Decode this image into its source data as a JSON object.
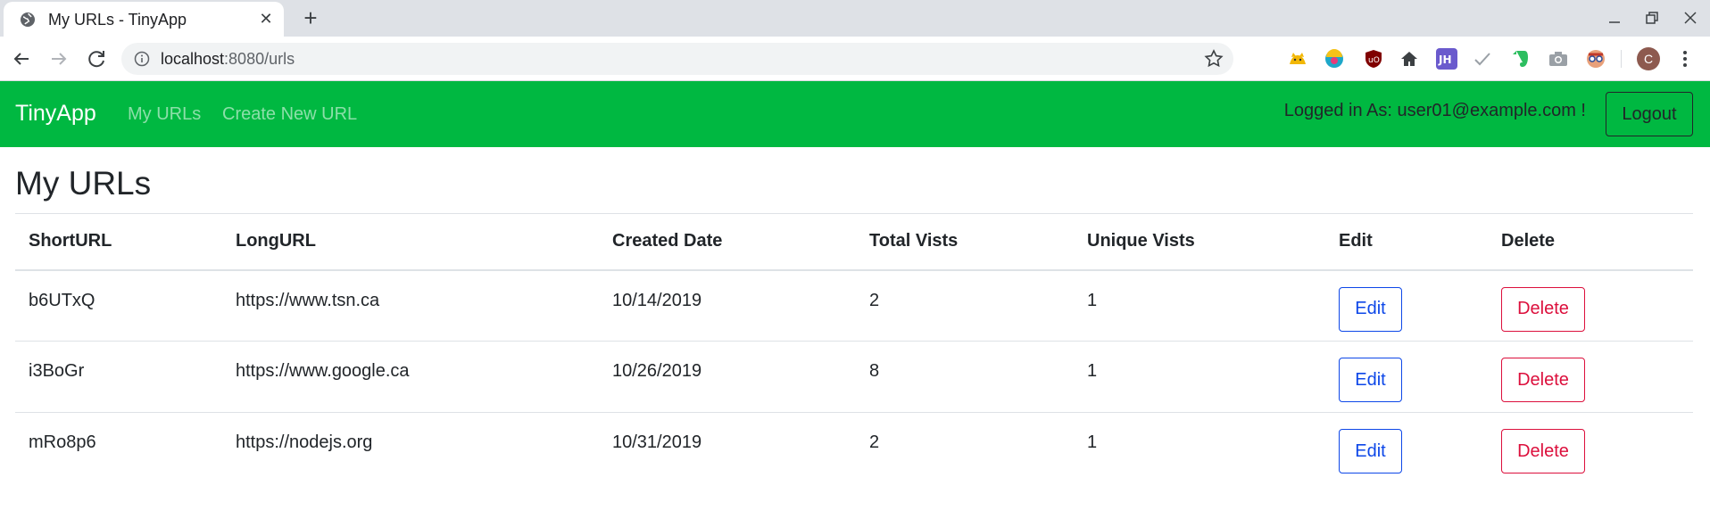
{
  "browser": {
    "tab_title": "My URLs - TinyApp",
    "tab_close": "✕",
    "new_tab": "+",
    "url_host": "localhost",
    "url_rest": ":8080/urls",
    "avatar_letter": "C"
  },
  "navbar": {
    "brand": "TinyApp",
    "links": [
      "My URLs",
      "Create New URL"
    ],
    "login_text": "Logged in As: user01@example.com !",
    "logout_label": "Logout",
    "bg_color": "#00b841"
  },
  "page": {
    "title": "My URLs"
  },
  "table": {
    "headers": [
      "ShortURL",
      "LongURL",
      "Created Date",
      "Total Vists",
      "Unique Vists",
      "Edit",
      "Delete"
    ],
    "rows": [
      {
        "short": "b6UTxQ",
        "long": "https://www.tsn.ca",
        "created": "10/14/2019",
        "total": "2",
        "unique": "1"
      },
      {
        "short": "i3BoGr",
        "long": "https://www.google.ca",
        "created": "10/26/2019",
        "total": "8",
        "unique": "1"
      },
      {
        "short": "mRo8p6",
        "long": "https://nodejs.org",
        "created": "10/31/2019",
        "total": "2",
        "unique": "1"
      }
    ],
    "edit_label": "Edit",
    "delete_label": "Delete"
  }
}
